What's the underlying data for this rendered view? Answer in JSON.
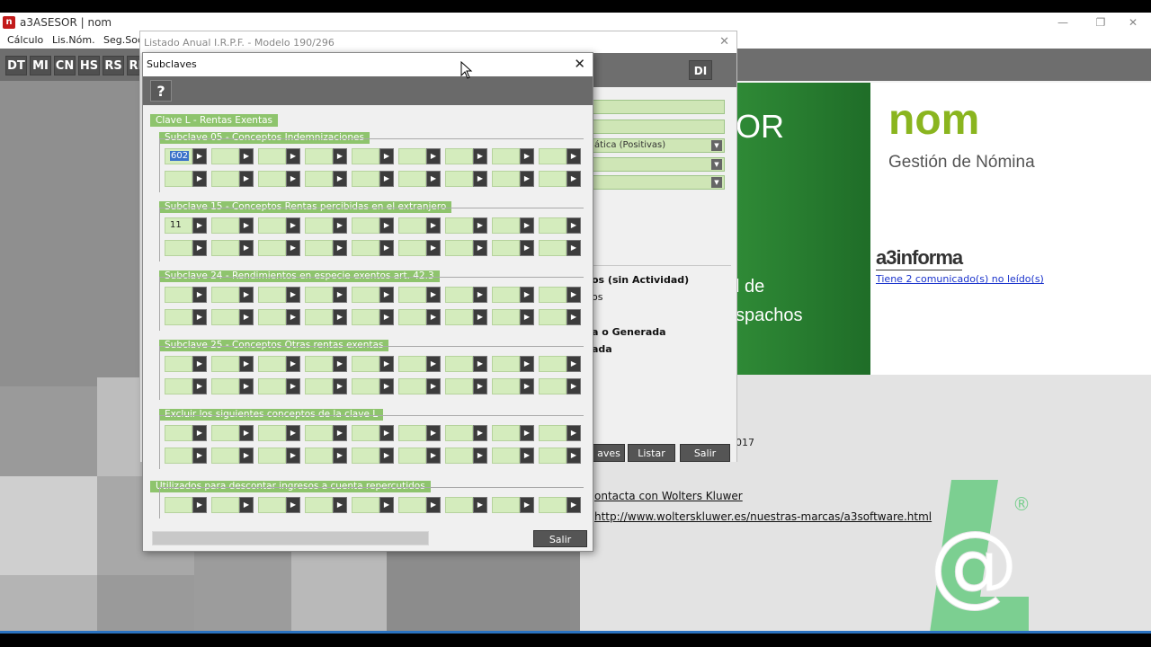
{
  "app": {
    "title": "a3ASESOR | nom",
    "logo_letter": "n",
    "win_controls": [
      "—",
      "❐",
      "✕"
    ],
    "menu": [
      "Cálculo",
      "Lis.Nóm.",
      "Seg.Soc."
    ],
    "toolbar": [
      "DT",
      "MI",
      "CN",
      "HS",
      "RS",
      "RE"
    ]
  },
  "bg_dialog": {
    "title": "Listado Anual I.R.P.F. - Modelo 190/296",
    "close": "✕",
    "di_button": "DI",
    "dropdown_value": "ática (Positivas)",
    "texts": [
      "os (sin Actividad)",
      "os",
      "a o Generada",
      "ada"
    ],
    "buttons": {
      "claves": "aves",
      "listar": "Listar",
      "salir": "Salir"
    }
  },
  "background": {
    "green_big": "OR",
    "green_texts": [
      "l de",
      "spachos"
    ],
    "product": "nom",
    "product_sub": "Gestión de Nómina",
    "a3_logo": "a3informa",
    "a3_link": "Tiene 2 comunicado(s) no leído(s)",
    "year": "017",
    "contact": "ontacta con Wolters Kluwer",
    "url": "http://www.wolterskluwer.es/nuestras-marcas/a3software.html",
    "logo_at": "@",
    "logo_reg": "®"
  },
  "dialog": {
    "title": "Subclaves",
    "close": "✕",
    "help": "?",
    "main_section": "Clave L - Rentas Exentas",
    "salir": "Salir",
    "groups": [
      {
        "label": "Subclave 05 - Conceptos  Indemnizaciones",
        "rows": 2,
        "values": {
          "0": "602"
        }
      },
      {
        "label": "Subclave 15 - Conceptos  Rentas percibidas en el extranjero",
        "rows": 2,
        "values": {
          "0": "11"
        }
      },
      {
        "label": "Subclave 24 - Rendimientos en especie exentos art. 42.3",
        "rows": 2,
        "values": {}
      },
      {
        "label": "Subclave 25 - Conceptos  Otras rentas exentas",
        "rows": 2,
        "values": {}
      },
      {
        "label": "Excluir los siguientes conceptos de la clave L",
        "rows": 2,
        "values": {}
      },
      {
        "label": "Utilizados para descontar ingresos a cuenta repercutidos",
        "rows": 1,
        "values": {}
      }
    ]
  }
}
